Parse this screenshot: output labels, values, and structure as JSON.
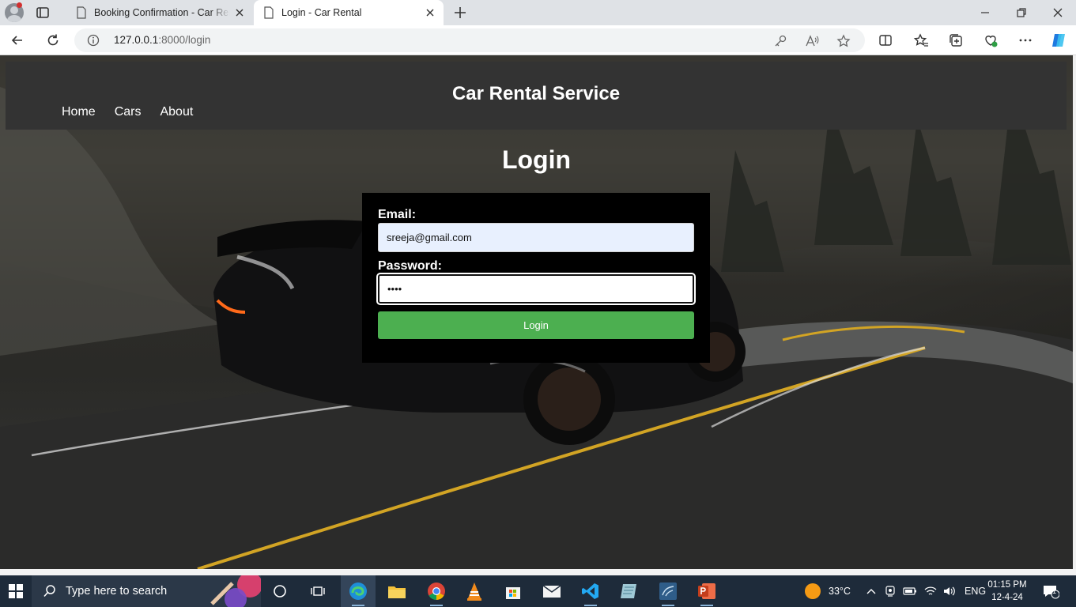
{
  "browser": {
    "tabs": [
      {
        "title": "Booking Confirmation - Car Rental",
        "active": false
      },
      {
        "title": "Login - Car Rental",
        "active": true
      }
    ],
    "url_host": "127.0.0.1",
    "url_path": ":8000/login"
  },
  "site": {
    "title": "Car Rental Service",
    "nav": [
      "Home",
      "Cars",
      "About"
    ]
  },
  "login": {
    "heading": "Login",
    "email_label": "Email:",
    "email_value": "sreeja@gmail.com",
    "password_label": "Password:",
    "password_value": "••••",
    "button_label": "Login"
  },
  "taskbar": {
    "search_placeholder": "Type here to search",
    "weather": "33°C",
    "language": "ENG",
    "time": "01:15 PM",
    "date": "12-4-24",
    "notification_count": "1"
  },
  "colors": {
    "header_bg": "#333333",
    "card_bg": "#000000",
    "button_bg": "#4caf50",
    "autofill_bg": "#e8f0fe",
    "taskbar_bg": "#1e2b3a"
  }
}
